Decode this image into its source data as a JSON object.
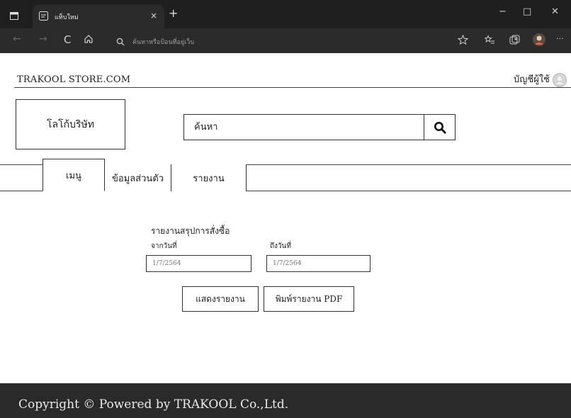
{
  "browser": {
    "tab_title": "แท็บใหม่",
    "tab_close": "×",
    "new_tab": "+",
    "address_placeholder": "ค้นหาหรือป้อนที่อยู่เว็บ",
    "window_controls": {
      "minimize": "−",
      "maximize": "□",
      "close": "✕"
    },
    "nav": {
      "back": "←",
      "forward": "→",
      "reload": "C",
      "more": "···"
    }
  },
  "header": {
    "site_name": "TRAKOOL STORE.COM",
    "user_account": "บัญชีผู้ใช้"
  },
  "logo": {
    "label": "โลโก้บริษัท"
  },
  "search": {
    "placeholder": "ค้นหา"
  },
  "menu": {
    "tabs": [
      {
        "label": "เมนู"
      },
      {
        "label": "ข้อมูลส่วนตัว"
      },
      {
        "label": "รายงาน"
      }
    ]
  },
  "report": {
    "title": "รายงานสรุปการสั่งซื้อ",
    "from_label": "จากวันที่",
    "to_label": "ถึงวันที่",
    "from_value": "1/7/2564",
    "to_value": "1/7/2564",
    "show_button": "แสดงรายงาน",
    "pdf_button": "พิมพ์รายงาน PDF"
  },
  "footer": {
    "copyright": "Copyright © Powered by TRAKOOL Co.,Ltd."
  }
}
